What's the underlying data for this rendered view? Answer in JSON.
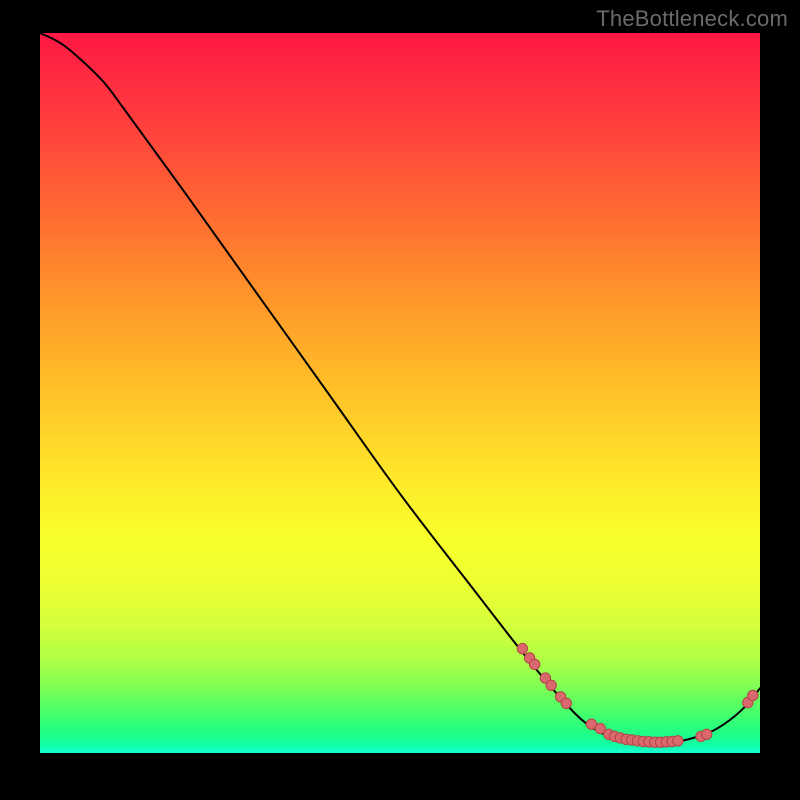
{
  "watermark": "TheBottleneck.com",
  "curve_label": "",
  "colors": {
    "marker_fill": "#d9696d",
    "marker_stroke": "#b24448",
    "line": "#000000"
  },
  "chart_data": {
    "type": "line",
    "title": "",
    "xlabel": "",
    "ylabel": "",
    "xlim": [
      0,
      100
    ],
    "ylim": [
      0,
      100
    ],
    "curve": [
      {
        "x": 0,
        "y": 100
      },
      {
        "x": 3,
        "y": 98.5
      },
      {
        "x": 6,
        "y": 96
      },
      {
        "x": 9,
        "y": 93
      },
      {
        "x": 12,
        "y": 89
      },
      {
        "x": 20,
        "y": 78
      },
      {
        "x": 30,
        "y": 64
      },
      {
        "x": 40,
        "y": 50
      },
      {
        "x": 50,
        "y": 36
      },
      {
        "x": 60,
        "y": 23
      },
      {
        "x": 67,
        "y": 14
      },
      {
        "x": 72,
        "y": 8
      },
      {
        "x": 76,
        "y": 4
      },
      {
        "x": 80,
        "y": 2
      },
      {
        "x": 84,
        "y": 1.5
      },
      {
        "x": 88,
        "y": 1.5
      },
      {
        "x": 92,
        "y": 2.5
      },
      {
        "x": 95,
        "y": 4
      },
      {
        "x": 98,
        "y": 6.5
      },
      {
        "x": 100,
        "y": 9
      }
    ],
    "marker_clusters": [
      {
        "x": 67.0,
        "y": 14.5
      },
      {
        "x": 68.0,
        "y": 13.2
      },
      {
        "x": 68.7,
        "y": 12.3
      },
      {
        "x": 70.2,
        "y": 10.4
      },
      {
        "x": 71.0,
        "y": 9.4
      },
      {
        "x": 72.3,
        "y": 7.8
      },
      {
        "x": 73.1,
        "y": 6.9
      },
      {
        "x": 76.6,
        "y": 4.0
      },
      {
        "x": 77.8,
        "y": 3.4
      },
      {
        "x": 79.0,
        "y": 2.6
      },
      {
        "x": 79.8,
        "y": 2.3
      },
      {
        "x": 80.6,
        "y": 2.1
      },
      {
        "x": 81.4,
        "y": 1.9
      },
      {
        "x": 82.2,
        "y": 1.8
      },
      {
        "x": 83.0,
        "y": 1.7
      },
      {
        "x": 83.8,
        "y": 1.6
      },
      {
        "x": 84.6,
        "y": 1.55
      },
      {
        "x": 85.4,
        "y": 1.5
      },
      {
        "x": 86.2,
        "y": 1.5
      },
      {
        "x": 87.0,
        "y": 1.55
      },
      {
        "x": 87.8,
        "y": 1.6
      },
      {
        "x": 88.6,
        "y": 1.7
      },
      {
        "x": 91.8,
        "y": 2.3
      },
      {
        "x": 92.6,
        "y": 2.6
      },
      {
        "x": 98.3,
        "y": 7.0
      },
      {
        "x": 99.0,
        "y": 8.0
      }
    ]
  }
}
